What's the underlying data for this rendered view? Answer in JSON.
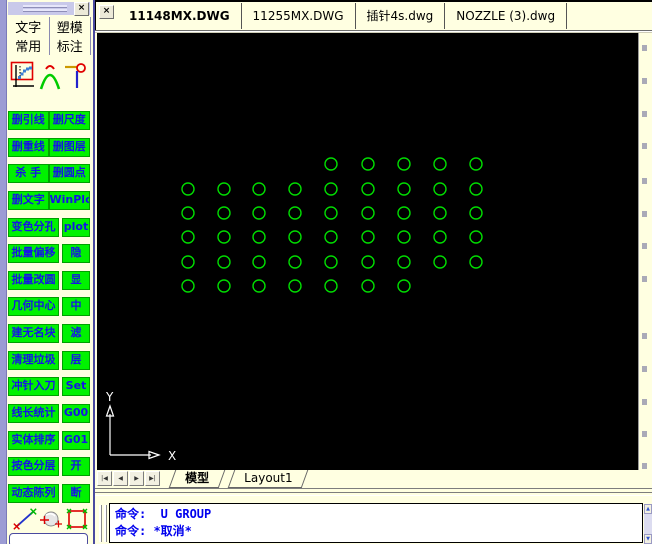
{
  "icons": {
    "close": "×",
    "scroll_up": "▲",
    "scroll_down": "▼"
  },
  "colors": {
    "palette_bg": "#FFFFE1",
    "button_green": "#00F200",
    "button_text": "#1414E6",
    "circle_green": "#00DD00",
    "command_text": "#0000EE",
    "canvas_bg": "#000000"
  },
  "palette": {
    "tabs": [
      "文字",
      "塑模",
      "常用",
      "标注"
    ],
    "top_tool_icons": [
      "curve-fit-icon",
      "arch-icon",
      "pin-icon"
    ],
    "buttons": [
      [
        "删引线",
        "删尺度"
      ],
      [
        "删重线",
        "删图层"
      ],
      [
        "杀 手",
        "删圆点"
      ],
      [
        "删文字",
        "WinPlot"
      ],
      [
        "变色分孔",
        "plot"
      ],
      [
        "批量偏移",
        "隐"
      ],
      [
        "批量改圆",
        "显"
      ],
      [
        "几何中心",
        "中"
      ],
      [
        "建无名块",
        "滤"
      ],
      [
        "清理垃圾",
        "层"
      ],
      [
        "冲针入刀",
        "Set"
      ],
      [
        "线长统计",
        "G00"
      ],
      [
        "实体排序",
        "G01"
      ],
      [
        "按色分层",
        "开"
      ],
      [
        "动态陈列",
        "断"
      ]
    ],
    "bottom_tool_icons": [
      "measure-line-icon",
      "sphere-icon",
      "select-box-icon"
    ],
    "input_value": ""
  },
  "doc_bar": {
    "tabs": [
      {
        "label": "11148MX.DWG",
        "active": true
      },
      {
        "label": "11255MX.DWG",
        "active": false
      },
      {
        "label": "插针4s.dwg",
        "active": false
      },
      {
        "label": "NOZZLE (3).dwg",
        "active": false
      }
    ]
  },
  "canvas": {
    "ucs": {
      "x_label": "X",
      "y_label": "Y"
    },
    "circles": {
      "color": "#00DD00",
      "radius": 6,
      "col_x": [
        91,
        127,
        162,
        198,
        234,
        271,
        307,
        343,
        379
      ],
      "row_y": [
        131,
        156,
        180,
        204,
        229,
        253
      ],
      "pattern": [
        [
          4,
          5,
          6,
          7,
          8
        ],
        [
          0,
          1,
          2,
          3,
          4,
          5,
          6,
          7,
          8
        ],
        [
          0,
          1,
          2,
          3,
          4,
          5,
          6,
          7,
          8
        ],
        [
          0,
          1,
          2,
          3,
          4,
          5,
          6,
          7,
          8
        ],
        [
          0,
          1,
          2,
          3,
          4,
          5,
          6,
          7,
          8
        ],
        [
          0,
          1,
          2,
          3,
          4,
          5,
          6
        ]
      ]
    }
  },
  "sheet_bar": {
    "nav": [
      "|◀",
      "◀",
      "▶",
      "▶|"
    ],
    "tabs": [
      {
        "label": "模型",
        "active": true
      },
      {
        "label": "Layout1",
        "active": false
      }
    ]
  },
  "command": {
    "lines": [
      "命令:  U GROUP",
      "命令: *取消*"
    ]
  }
}
